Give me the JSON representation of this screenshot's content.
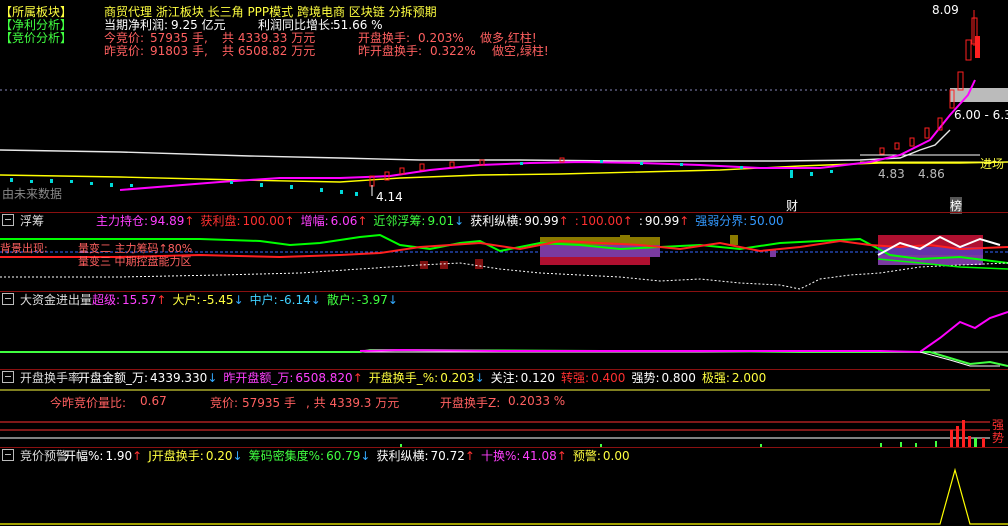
{
  "tags": {
    "sector": "【所属板块】",
    "profit": "【净利分析】",
    "bid": "【竞价分析】"
  },
  "header": {
    "concepts": "商贸代理  浙江板块  长三角 PPP模式 跨境电商 区块链 分拆预期",
    "net_profit_label": "当期净利润:",
    "net_profit_value": "9.25 亿元",
    "profit_growth_label": "利润同比增长:",
    "profit_growth_value": "51.66 %",
    "today_bid_label": "今竞价:",
    "today_bid_shares": "57935 手,",
    "today_bid_amount": "共 4339.33 万元",
    "today_open_turnover_label": "开盘换手:",
    "today_open_turnover_value": "0.203%",
    "today_advice": "做多,红柱!",
    "yday_bid_label": "昨竞价:",
    "yday_bid_shares": "91803 手,",
    "yday_bid_amount": "共 6508.82 万元",
    "yday_open_turnover_label": "昨开盘换手:",
    "yday_open_turnover_value": "0.322%",
    "yday_advice": "做空,绿柱!"
  },
  "price_panel": {
    "high_label": "8.09",
    "right_label_a": "6.00 - 6.3",
    "entry_label": "进场",
    "low_label": "4.14",
    "low_label_b": "4.83",
    "low_label_c": "4.86",
    "future_label": "由未来数据",
    "marker_cai": "财",
    "marker_bang": "榜",
    "colors": {
      "up": "#ff2020",
      "down": "#00e0e0",
      "ma_magenta": "#ff00ff",
      "ma_yellow": "#ffff00",
      "ma_white": "#ffffff"
    }
  },
  "chip_panel": {
    "title": "浮筹",
    "items": [
      {
        "label": "主力持仓:",
        "value": "94.89",
        "dir": "up",
        "color": "#ff40ff"
      },
      {
        "label": "获利盘:",
        "value": "100.00",
        "dir": "up",
        "color": "#ff3030"
      },
      {
        "label": "增幅:",
        "value": "6.06",
        "dir": "up",
        "color": "#ff40ff"
      },
      {
        "label": "近邻浮筹:",
        "value": "9.01",
        "dir": "down",
        "color": "#40ff40"
      },
      {
        "label": "获利纵横:",
        "value": "90.99",
        "dir": "up",
        "color": "#ffffff"
      },
      {
        "label": ":",
        "value": "100.00",
        "dir": "up",
        "color": "#ff3030"
      },
      {
        "label": ":",
        "value": "90.99",
        "dir": "up",
        "color": "#ffffff"
      },
      {
        "label": "强弱分界:",
        "value": "50.00",
        "dir": "",
        "color": "#3399ff"
      }
    ],
    "overlay_a": "背景出现:",
    "overlay_b": "量变二  主力筹码↑80%",
    "overlay_c": "量变三  中期控盘能力区"
  },
  "fund_panel": {
    "title": "大资金进出量",
    "items": [
      {
        "label": "超级:",
        "value": "15.57",
        "dir": "up",
        "color": "#ff40ff"
      },
      {
        "label": "大户:",
        "value": "-5.45",
        "dir": "down",
        "color": "#ffff40"
      },
      {
        "label": "中户:",
        "value": "-6.14",
        "dir": "down",
        "color": "#40d0ff"
      },
      {
        "label": "散户:",
        "value": "-3.97",
        "dir": "down",
        "color": "#40ff40"
      }
    ]
  },
  "turnover_panel": {
    "title": "开盘换手率",
    "items": [
      {
        "label": "开盘金额_万:",
        "value": "4339.330",
        "dir": "down",
        "color": "#ffffff"
      },
      {
        "label": "昨开盘额_万:",
        "value": "6508.820",
        "dir": "up",
        "color": "#ff40ff"
      },
      {
        "label": "开盘换手_%:",
        "value": "0.203",
        "dir": "down",
        "color": "#ffff40"
      },
      {
        "label": "关注:",
        "value": "0.120",
        "dir": "",
        "color": "#ffffff"
      },
      {
        "label": "转强:",
        "value": "0.400",
        "dir": "",
        "color": "#ff3030"
      },
      {
        "label": "强势:",
        "value": "0.800",
        "dir": "",
        "color": "#ffffff"
      },
      {
        "label": "极强:",
        "value": "2.000",
        "dir": "",
        "color": "#ffff40"
      }
    ],
    "ratio_label": "今昨竞价量比:",
    "ratio_value": "0.67",
    "bid_label": "竞价:",
    "bid_shares": "57935 手",
    "bid_amount": ", 共 4339.3 万元",
    "open_turn_label": "开盘换手Z:",
    "open_turn_value": "0.2033 %",
    "right_a": "强",
    "right_b": "势"
  },
  "warn_panel": {
    "title": "竞价预警",
    "items": [
      {
        "label": "开幅%:",
        "value": "1.90",
        "dir": "up",
        "color": "#ffffff"
      },
      {
        "label": "J开盘换手:",
        "value": "0.20",
        "dir": "down",
        "color": "#ffff40"
      },
      {
        "label": "筹码密集度%:",
        "value": "60.79",
        "dir": "down",
        "color": "#40ff40"
      },
      {
        "label": "获利纵横:",
        "value": "70.72",
        "dir": "up",
        "color": "#ffffff"
      },
      {
        "label": "十换%:",
        "value": "41.08",
        "dir": "up",
        "color": "#ff40ff"
      },
      {
        "label": "预警:",
        "value": "0.00",
        "dir": "",
        "color": "#ffff40"
      }
    ]
  }
}
